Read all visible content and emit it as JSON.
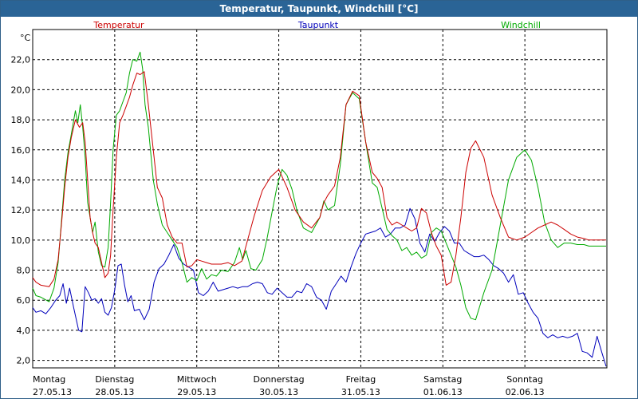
{
  "window": {
    "title": "Temperatur, Taupunkt, Windchill [°C]"
  },
  "chart_data": {
    "type": "line",
    "title": "Temperatur, Taupunkt, Windchill [°C]",
    "ylabel": "°C",
    "xlabel": "",
    "ylim": [
      1.5,
      24.0
    ],
    "yticks": [
      2.0,
      4.0,
      6.0,
      8.0,
      10.0,
      12.0,
      14.0,
      16.0,
      18.0,
      20.0,
      22.0
    ],
    "ytick_labels": [
      "2,0",
      "4,0",
      "6,0",
      "8,0",
      "10,0",
      "12,0",
      "14,0",
      "16,0",
      "18,0",
      "20,0",
      "22,0"
    ],
    "xlim": [
      0,
      7.0
    ],
    "days": [
      {
        "weekday": "Montag",
        "date": "27.05.13"
      },
      {
        "weekday": "Dienstag",
        "date": "28.05.13"
      },
      {
        "weekday": "Mittwoch",
        "date": "29.05.13"
      },
      {
        "weekday": "Donnerstag",
        "date": "30.05.13"
      },
      {
        "weekday": "Freitag",
        "date": "31.05.13"
      },
      {
        "weekday": "Samstag",
        "date": "01.06.13"
      },
      {
        "weekday": "Sonntag",
        "date": "02.06.13"
      }
    ],
    "grid": true,
    "legend_position": "top",
    "series": [
      {
        "name": "Temperatur",
        "color": "#cc0000",
        "x": [
          0.0,
          0.04,
          0.1,
          0.2,
          0.26,
          0.31,
          0.35,
          0.39,
          0.43,
          0.47,
          0.52,
          0.57,
          0.61,
          0.64,
          0.67,
          0.7,
          0.73,
          0.76,
          0.8,
          0.84,
          0.88,
          0.92,
          0.95,
          0.98,
          1.02,
          1.06,
          1.1,
          1.14,
          1.18,
          1.22,
          1.27,
          1.31,
          1.36,
          1.41,
          1.47,
          1.52,
          1.58,
          1.64,
          1.7,
          1.76,
          1.82,
          1.88,
          1.94,
          2.0,
          2.06,
          2.12,
          2.18,
          2.24,
          2.3,
          2.38,
          2.46,
          2.55,
          2.62,
          2.7,
          2.8,
          2.9,
          3.0,
          3.1,
          3.2,
          3.3,
          3.4,
          3.5,
          3.55,
          3.6,
          3.68,
          3.75,
          3.82,
          3.9,
          3.98,
          4.06,
          4.14,
          4.2,
          4.26,
          4.32,
          4.38,
          4.44,
          4.5,
          4.56,
          4.62,
          4.68,
          4.74,
          4.8,
          4.86,
          4.92,
          4.98,
          5.04,
          5.1,
          5.16,
          5.22,
          5.28,
          5.34,
          5.4,
          5.5,
          5.6,
          5.7,
          5.8,
          5.9,
          6.0,
          6.08,
          6.16,
          6.24,
          6.32,
          6.4,
          6.48,
          6.56,
          6.64,
          6.72,
          6.78,
          6.84,
          6.92,
          6.99
        ],
        "values": [
          7.5,
          7.2,
          7.0,
          6.9,
          7.4,
          8.7,
          11.0,
          13.5,
          15.5,
          16.8,
          18.0,
          17.5,
          17.8,
          16.5,
          14.0,
          11.5,
          10.5,
          9.8,
          9.5,
          8.5,
          7.5,
          7.8,
          9.0,
          12.0,
          15.5,
          17.8,
          18.3,
          18.9,
          19.5,
          20.3,
          21.1,
          21.0,
          21.2,
          19.0,
          16.0,
          13.5,
          12.8,
          11.0,
          10.2,
          9.8,
          9.8,
          8.2,
          8.3,
          8.7,
          8.6,
          8.5,
          8.4,
          8.4,
          8.4,
          8.5,
          8.3,
          8.6,
          10.0,
          11.6,
          13.3,
          14.2,
          14.7,
          13.5,
          12.0,
          11.2,
          10.8,
          11.5,
          12.5,
          13.0,
          13.6,
          15.5,
          19.0,
          19.9,
          19.6,
          16.5,
          14.5,
          14.1,
          13.5,
          11.5,
          11.0,
          11.2,
          11.0,
          10.8,
          10.6,
          10.8,
          12.1,
          11.8,
          10.5,
          9.6,
          9.0,
          7.0,
          7.2,
          9.0,
          11.5,
          14.5,
          16.1,
          16.6,
          15.5,
          13.0,
          11.5,
          10.2,
          10.0,
          10.2,
          10.5,
          10.8,
          11.0,
          11.2,
          11.0,
          10.7,
          10.4,
          10.2,
          10.1,
          10.0,
          10.0,
          10.0,
          10.0
        ]
      },
      {
        "name": "Taupunkt",
        "color": "#0000bb",
        "x": [
          0.0,
          0.04,
          0.1,
          0.16,
          0.22,
          0.28,
          0.33,
          0.37,
          0.41,
          0.45,
          0.5,
          0.56,
          0.6,
          0.64,
          0.68,
          0.72,
          0.76,
          0.8,
          0.84,
          0.88,
          0.92,
          0.96,
          1.0,
          1.04,
          1.08,
          1.12,
          1.16,
          1.2,
          1.24,
          1.3,
          1.36,
          1.42,
          1.48,
          1.54,
          1.6,
          1.66,
          1.72,
          1.78,
          1.84,
          1.9,
          1.96,
          2.02,
          2.08,
          2.14,
          2.2,
          2.26,
          2.32,
          2.38,
          2.44,
          2.5,
          2.56,
          2.62,
          2.68,
          2.74,
          2.8,
          2.86,
          2.92,
          2.98,
          3.04,
          3.1,
          3.16,
          3.22,
          3.28,
          3.34,
          3.4,
          3.46,
          3.52,
          3.58,
          3.64,
          3.7,
          3.76,
          3.82,
          3.88,
          3.94,
          4.0,
          4.06,
          4.12,
          4.18,
          4.24,
          4.3,
          4.36,
          4.42,
          4.48,
          4.54,
          4.6,
          4.66,
          4.72,
          4.78,
          4.84,
          4.9,
          4.96,
          5.02,
          5.08,
          5.14,
          5.2,
          5.26,
          5.32,
          5.38,
          5.44,
          5.5,
          5.56,
          5.62,
          5.68,
          5.74,
          5.8,
          5.86,
          5.92,
          5.98,
          6.04,
          6.1,
          6.16,
          6.22,
          6.28,
          6.34,
          6.4,
          6.46,
          6.52,
          6.58,
          6.64,
          6.7,
          6.76,
          6.82,
          6.88,
          6.94,
          6.99
        ],
        "values": [
          5.5,
          5.2,
          5.3,
          5.1,
          5.5,
          6.0,
          6.3,
          7.1,
          5.8,
          6.8,
          5.5,
          4.0,
          3.9,
          6.9,
          6.5,
          6.0,
          6.1,
          5.8,
          6.1,
          5.2,
          5.0,
          5.5,
          6.7,
          8.3,
          8.4,
          7.0,
          5.9,
          6.3,
          5.3,
          5.4,
          4.7,
          5.4,
          7.2,
          8.1,
          8.4,
          9.0,
          9.7,
          8.8,
          8.4,
          8.2,
          8.0,
          6.5,
          6.3,
          6.6,
          7.2,
          6.6,
          6.7,
          6.8,
          6.9,
          6.8,
          6.9,
          6.9,
          7.1,
          7.2,
          7.1,
          6.5,
          6.4,
          6.8,
          6.5,
          6.2,
          6.2,
          6.6,
          6.5,
          7.1,
          6.9,
          6.2,
          6.0,
          5.4,
          6.6,
          7.1,
          7.6,
          7.2,
          8.2,
          9.1,
          9.8,
          10.4,
          10.5,
          10.6,
          10.8,
          10.2,
          10.4,
          10.8,
          10.8,
          11.0,
          12.1,
          11.4,
          9.8,
          9.2,
          10.4,
          9.9,
          10.5,
          10.9,
          10.6,
          9.8,
          9.8,
          9.3,
          9.1,
          8.9,
          8.9,
          9.0,
          8.7,
          8.3,
          8.1,
          7.8,
          7.2,
          7.7,
          6.4,
          6.5,
          5.8,
          5.2,
          4.8,
          3.8,
          3.5,
          3.7,
          3.5,
          3.6,
          3.5,
          3.6,
          3.8,
          2.6,
          2.5,
          2.2,
          3.6,
          2.5,
          1.6
        ]
      },
      {
        "name": "Windchill",
        "color": "#00aa00",
        "x": [
          0.0,
          0.04,
          0.1,
          0.2,
          0.26,
          0.31,
          0.35,
          0.39,
          0.43,
          0.47,
          0.52,
          0.55,
          0.58,
          0.61,
          0.64,
          0.67,
          0.7,
          0.73,
          0.76,
          0.8,
          0.84,
          0.88,
          0.92,
          0.95,
          0.98,
          1.02,
          1.06,
          1.1,
          1.14,
          1.18,
          1.22,
          1.27,
          1.31,
          1.34,
          1.37,
          1.41,
          1.47,
          1.52,
          1.58,
          1.64,
          1.7,
          1.76,
          1.82,
          1.88,
          1.94,
          2.0,
          2.06,
          2.12,
          2.18,
          2.24,
          2.3,
          2.38,
          2.46,
          2.52,
          2.56,
          2.6,
          2.66,
          2.72,
          2.8,
          2.86,
          2.92,
          2.98,
          3.04,
          3.1,
          3.16,
          3.22,
          3.3,
          3.4,
          3.5,
          3.55,
          3.6,
          3.68,
          3.75,
          3.82,
          3.9,
          3.98,
          4.06,
          4.14,
          4.2,
          4.26,
          4.32,
          4.38,
          4.44,
          4.5,
          4.56,
          4.62,
          4.68,
          4.74,
          4.8,
          4.86,
          4.92,
          4.98,
          5.04,
          5.1,
          5.16,
          5.22,
          5.28,
          5.34,
          5.4,
          5.5,
          5.6,
          5.7,
          5.8,
          5.9,
          6.0,
          6.08,
          6.16,
          6.24,
          6.32,
          6.4,
          6.48,
          6.56,
          6.64,
          6.72,
          6.78,
          6.84,
          6.92,
          6.99
        ],
        "values": [
          6.8,
          6.3,
          6.2,
          5.9,
          6.8,
          8.5,
          11.2,
          14.0,
          15.8,
          17.0,
          18.6,
          17.8,
          19.0,
          17.5,
          15.5,
          12.5,
          11.5,
          10.5,
          11.2,
          9.2,
          8.3,
          8.2,
          9.5,
          12.5,
          16.0,
          18.3,
          18.6,
          19.2,
          19.8,
          21.1,
          22.0,
          21.9,
          22.5,
          21.4,
          19.0,
          17.5,
          14.0,
          12.4,
          11.0,
          10.5,
          10.0,
          9.5,
          8.5,
          7.2,
          7.5,
          7.3,
          8.1,
          7.4,
          7.7,
          7.6,
          8.0,
          7.9,
          8.5,
          9.5,
          8.7,
          9.3,
          8.1,
          8.0,
          8.7,
          10.2,
          11.9,
          13.6,
          14.7,
          14.3,
          13.4,
          12.0,
          10.8,
          10.5,
          11.5,
          12.6,
          12.0,
          12.3,
          15.0,
          19.0,
          19.8,
          19.4,
          16.5,
          13.8,
          13.5,
          12.1,
          10.7,
          10.3,
          10.0,
          9.3,
          9.5,
          9.0,
          9.2,
          8.8,
          9.0,
          10.5,
          10.8,
          10.6,
          9.8,
          9.0,
          8.2,
          7.0,
          5.5,
          4.8,
          4.7,
          6.5,
          8.0,
          11.0,
          14.0,
          15.5,
          16.0,
          15.3,
          13.5,
          11.2,
          10.0,
          9.5,
          9.8,
          9.8,
          9.7,
          9.7,
          9.6,
          9.6,
          9.6,
          9.6
        ]
      }
    ]
  }
}
